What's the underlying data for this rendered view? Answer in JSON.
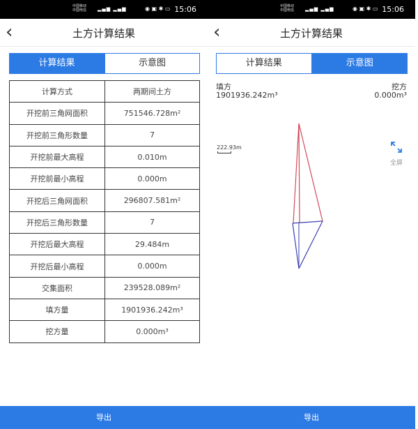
{
  "statusbar": {
    "carrier1": "中国移动",
    "carrier2": "中国电信",
    "time": "15:06"
  },
  "left": {
    "title": "土方计算结果",
    "tabs": [
      "计算结果",
      "示意图"
    ],
    "table": [
      [
        "计算方式",
        "两期间土方"
      ],
      [
        "开挖前三角网面积",
        "751546.728m²"
      ],
      [
        "开挖前三角形数量",
        "7"
      ],
      [
        "开挖前最大高程",
        "0.010m"
      ],
      [
        "开挖前最小高程",
        "0.000m"
      ],
      [
        "开挖后三角网面积",
        "296807.581m²"
      ],
      [
        "开挖后三角形数量",
        "7"
      ],
      [
        "开挖后最大高程",
        "29.484m"
      ],
      [
        "开挖后最小高程",
        "0.000m"
      ],
      [
        "交集面积",
        "239528.089m²"
      ],
      [
        "填方量",
        "1901936.242m³"
      ],
      [
        "挖方量",
        "0.000m³"
      ]
    ],
    "export_label": "导出"
  },
  "right": {
    "title": "土方计算结果",
    "tabs": [
      "计算结果",
      "示意图"
    ],
    "fill_label": "填方",
    "fill_value": "1901936.242m³",
    "cut_label": "挖方",
    "cut_value": "0.000m³",
    "scale_label": "222.93m",
    "fullscreen_label": "全屏",
    "export_label": "导出",
    "colors": {
      "fill_lines": "#d04a5a",
      "cut_lines": "#3a3fb0"
    }
  },
  "colors": {
    "accent": "#2c7be5"
  }
}
